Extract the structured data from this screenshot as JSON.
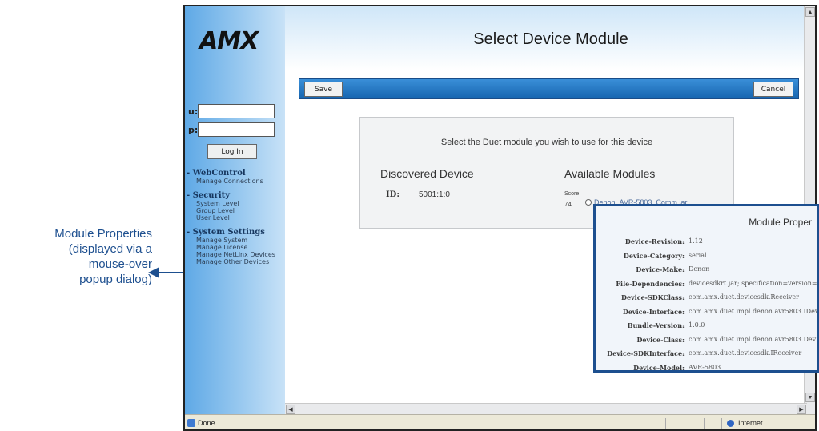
{
  "callout": {
    "lines": [
      "Module Properties",
      "(displayed via a",
      "mouse-over",
      "popup dialog)"
    ]
  },
  "sidebar": {
    "logo": "AMX",
    "login": {
      "user_label": "u:",
      "pass_label": "p:",
      "button": "Log In"
    },
    "groups": [
      {
        "title": "- WebControl",
        "items": [
          "Manage Connections"
        ]
      },
      {
        "title": "- Security",
        "items": [
          "System Level",
          "Group Level",
          "User Level"
        ]
      },
      {
        "title": "- System Settings",
        "items": [
          "Manage System",
          "Manage License",
          "Manage NetLinx Devices",
          "Manage Other Devices"
        ]
      }
    ]
  },
  "page": {
    "title": "Select Device Module"
  },
  "toolbar": {
    "save_label": "Save",
    "cancel_label": "Cancel"
  },
  "select_panel": {
    "instruction": "Select the Duet module you wish to use for this device",
    "discovered_title": "Discovered Device",
    "id_label": "ID:",
    "id_value": "5001:1:0",
    "available_title": "Available Modules",
    "score_label": "Score",
    "score_value": "74",
    "module_name": "Denon_AVR-5803_Comm.jar"
  },
  "popup": {
    "title": "Module Proper",
    "properties": [
      {
        "key": "Device-Revision:",
        "value": "1.12"
      },
      {
        "key": "Device-Category:",
        "value": "serial"
      },
      {
        "key": "Device-Make:",
        "value": "Denon"
      },
      {
        "key": "File-Dependencies:",
        "value": "devicesdkrt.jar; specification=version=1"
      },
      {
        "key": "Device-SDKClass:",
        "value": "com.amx.duet.devicesdk.Receiver"
      },
      {
        "key": "Device-Interface:",
        "value": "com.amx.duet.impl.denon.avr5803.IDev"
      },
      {
        "key": "Bundle-Version:",
        "value": "1.0.0"
      },
      {
        "key": "Device-Class:",
        "value": "com.amx.duet.impl.denon.avr5803.Dev"
      },
      {
        "key": "Device-SDKInterface:",
        "value": "com.amx.duet.devicesdk.IReceiver"
      },
      {
        "key": "Device-Model:",
        "value": "AVR-5803"
      }
    ]
  },
  "statusbar": {
    "status": "Done",
    "zone": "Internet"
  },
  "colors": {
    "callout": "#1d4f8f",
    "toolbar": "#1765b0",
    "sidebar": "#5fa9e6"
  }
}
